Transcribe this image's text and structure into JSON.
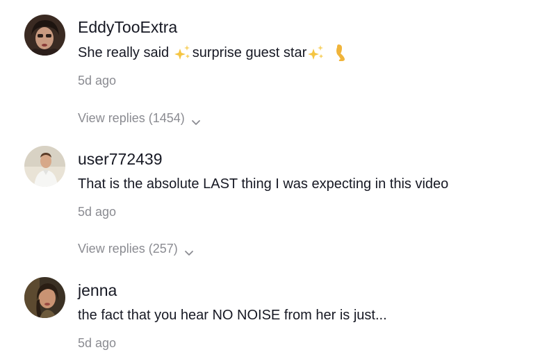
{
  "comments": [
    {
      "username": "EddyTooExtra",
      "text_before": "She really said ",
      "emoji_1": "sparkles-icon",
      "text_middle": "surprise guest star",
      "emoji_2": "sparkles-icon",
      "emoji_3": "leg-icon",
      "time": "5d ago",
      "replies_label": "View replies (1454)"
    },
    {
      "username": "user772439",
      "text": "That is the absolute LAST thing I was expecting in this video",
      "time": "5d ago",
      "replies_label": "View replies (257)"
    },
    {
      "username": "jenna",
      "text": "the fact that you hear NO NOISE from her is just...",
      "time": "5d ago"
    }
  ],
  "colors": {
    "primary_text": "#161823",
    "secondary_text": "#8a8b91",
    "background": "#ffffff",
    "sparkle": "#f5c542",
    "leg": "#f0b43a"
  }
}
